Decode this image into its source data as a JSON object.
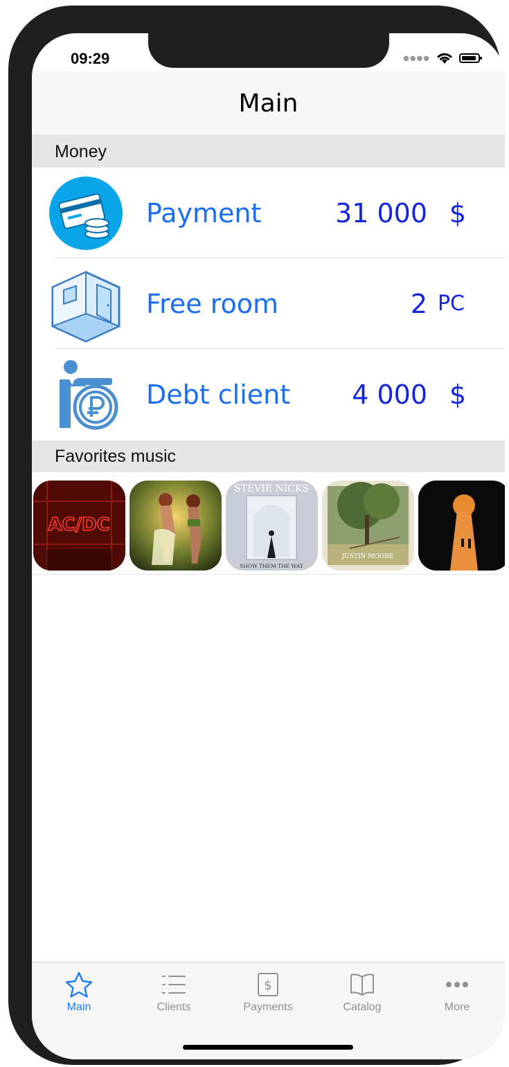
{
  "status": {
    "time": "09:29"
  },
  "nav": {
    "title": "Main"
  },
  "sections": {
    "money": "Money",
    "music": "Favorites music"
  },
  "rows": [
    {
      "label": "Payment",
      "value": "31 000",
      "unit": "$",
      "icon": "credit-card-coins-icon"
    },
    {
      "label": "Free room",
      "value": "2",
      "unit": "PC",
      "icon": "room-icon"
    },
    {
      "label": "Debt client",
      "value": "4 000",
      "unit": "$",
      "icon": "person-ruble-icon"
    }
  ],
  "albums": [
    {
      "art_text": "AC/DC",
      "accent": "#c21a12"
    },
    {
      "art_text": "",
      "accent": "#d9a441"
    },
    {
      "art_text": "STEVIE NICKS",
      "art_text_bottom": "SHOW THEM THE WAY",
      "accent": "#c9ced6"
    },
    {
      "art_text": "JUSTIN MOORE",
      "accent": "#a8b48a"
    },
    {
      "art_text": "",
      "accent": "#e07b2a"
    }
  ],
  "tabs": [
    {
      "label": "Main",
      "icon": "star-icon",
      "active": true
    },
    {
      "label": "Clients",
      "icon": "list-icon",
      "active": false
    },
    {
      "label": "Payments",
      "icon": "dollar-icon",
      "active": false
    },
    {
      "label": "Catalog",
      "icon": "book-icon",
      "active": false
    },
    {
      "label": "More",
      "icon": "more-icon",
      "active": false
    }
  ],
  "colors": {
    "accent": "#1a7cf5",
    "label": "#1a6ef5",
    "value": "#1226e0"
  }
}
